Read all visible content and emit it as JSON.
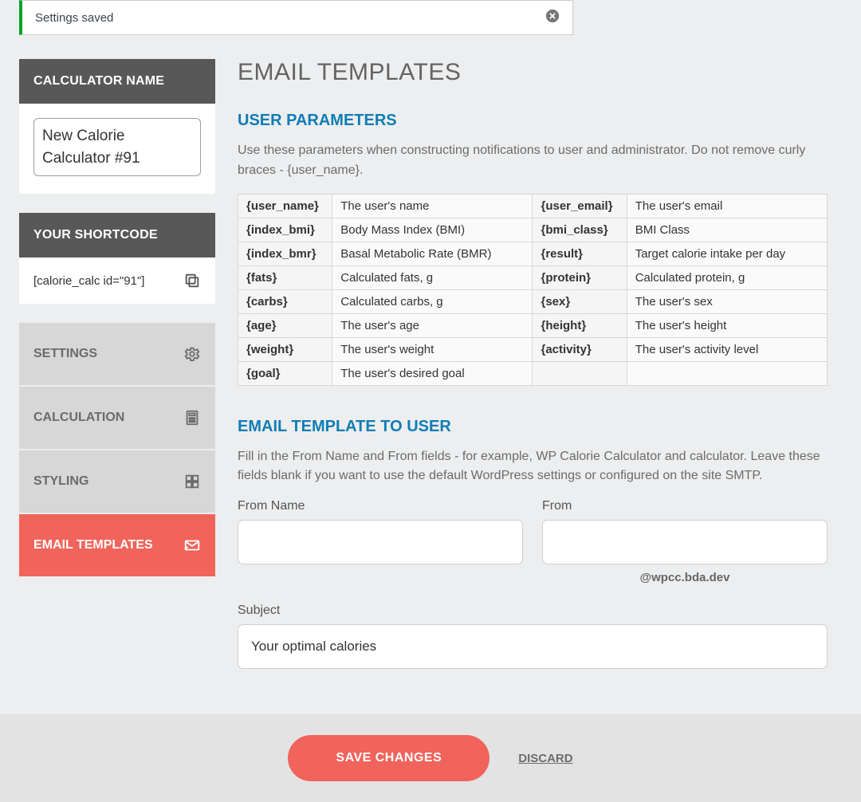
{
  "notice": {
    "text": "Settings saved"
  },
  "sidebar": {
    "calc_name_heading": "CALCULATOR NAME",
    "calc_name_value": "New Calorie Calculator #91",
    "shortcode_heading": "YOUR SHORTCODE",
    "shortcode_value": "[calorie_calc id=\"91\"]",
    "tabs": [
      {
        "label": "SETTINGS"
      },
      {
        "label": "CALCULATION"
      },
      {
        "label": "STYLING"
      },
      {
        "label": "EMAIL TEMPLATES"
      }
    ]
  },
  "main": {
    "title": "EMAIL TEMPLATES",
    "user_params": {
      "heading": "USER PARAMETERS",
      "hint": "Use these parameters when constructing notifications to user and administrator. Do not remove curly braces - {user_name}.",
      "rows": [
        [
          "{user_name}",
          "The user's name",
          "{user_email}",
          "The user's email"
        ],
        [
          "{index_bmi}",
          "Body Mass Index (BMI)",
          "{bmi_class}",
          "BMI Class"
        ],
        [
          "{index_bmr}",
          "Basal Metabolic Rate (BMR)",
          "{result}",
          "Target calorie intake per day"
        ],
        [
          "{fats}",
          "Calculated fats, g",
          "{protein}",
          "Calculated protein, g"
        ],
        [
          "{carbs}",
          "Calculated carbs, g",
          "{sex}",
          "The user's sex"
        ],
        [
          "{age}",
          "The user's age",
          "{height}",
          "The user's height"
        ],
        [
          "{weight}",
          "The user's weight",
          "{activity}",
          "The user's activity level"
        ],
        [
          "{goal}",
          "The user's desired goal",
          "",
          ""
        ]
      ]
    },
    "template_user": {
      "heading": "EMAIL TEMPLATE TO USER",
      "hint": "Fill in the From Name and From fields - for example, WP Calorie Calculator and calculator. Leave these fields blank if you want to use the default WordPress settings or configured on the site SMTP.",
      "from_name_label": "From Name",
      "from_name_value": "",
      "from_label": "From",
      "from_value": "",
      "from_helper": "@wpcc.bda.dev",
      "subject_label": "Subject",
      "subject_value": "Your optimal calories"
    }
  },
  "footer": {
    "save": "SAVE CHANGES",
    "discard": "DISCARD"
  }
}
